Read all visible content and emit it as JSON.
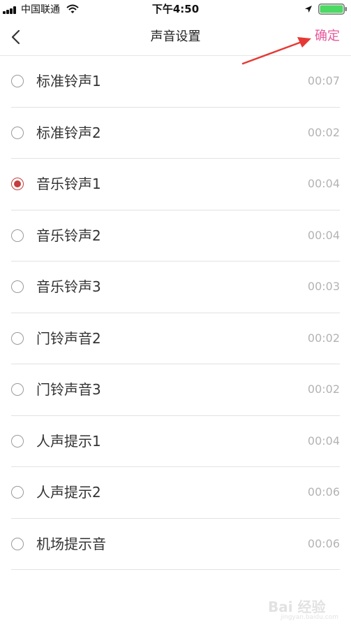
{
  "status_bar": {
    "carrier": "中国联通",
    "time": "下午4:50",
    "icons": [
      "signal-icon",
      "wifi-icon",
      "location-icon",
      "battery-icon"
    ],
    "battery_level": 1.0
  },
  "nav": {
    "title": "声音设置",
    "confirm_label": "确定",
    "back_icon": "chevron-left-icon"
  },
  "ringtones": [
    {
      "name": "标准铃声1",
      "duration": "00:07",
      "selected": false
    },
    {
      "name": "标准铃声2",
      "duration": "00:02",
      "selected": false
    },
    {
      "name": "音乐铃声1",
      "duration": "00:04",
      "selected": true
    },
    {
      "name": "音乐铃声2",
      "duration": "00:04",
      "selected": false
    },
    {
      "name": "音乐铃声3",
      "duration": "00:03",
      "selected": false
    },
    {
      "name": "门铃声音2",
      "duration": "00:02",
      "selected": false
    },
    {
      "name": "门铃声音3",
      "duration": "00:02",
      "selected": false
    },
    {
      "name": "人声提示1",
      "duration": "00:04",
      "selected": false
    },
    {
      "name": "人声提示2",
      "duration": "00:06",
      "selected": false
    },
    {
      "name": "机场提示音",
      "duration": "00:06",
      "selected": false
    }
  ],
  "colors": {
    "accent": "#e8579b",
    "selected_radio": "#c53d3d",
    "annotation_arrow": "#e53935",
    "duration_text": "#b3b3b3",
    "battery_fill": "#4cd964"
  },
  "watermark": {
    "logo": "Bai 经验",
    "sub": "jingyan.baidu.com"
  }
}
